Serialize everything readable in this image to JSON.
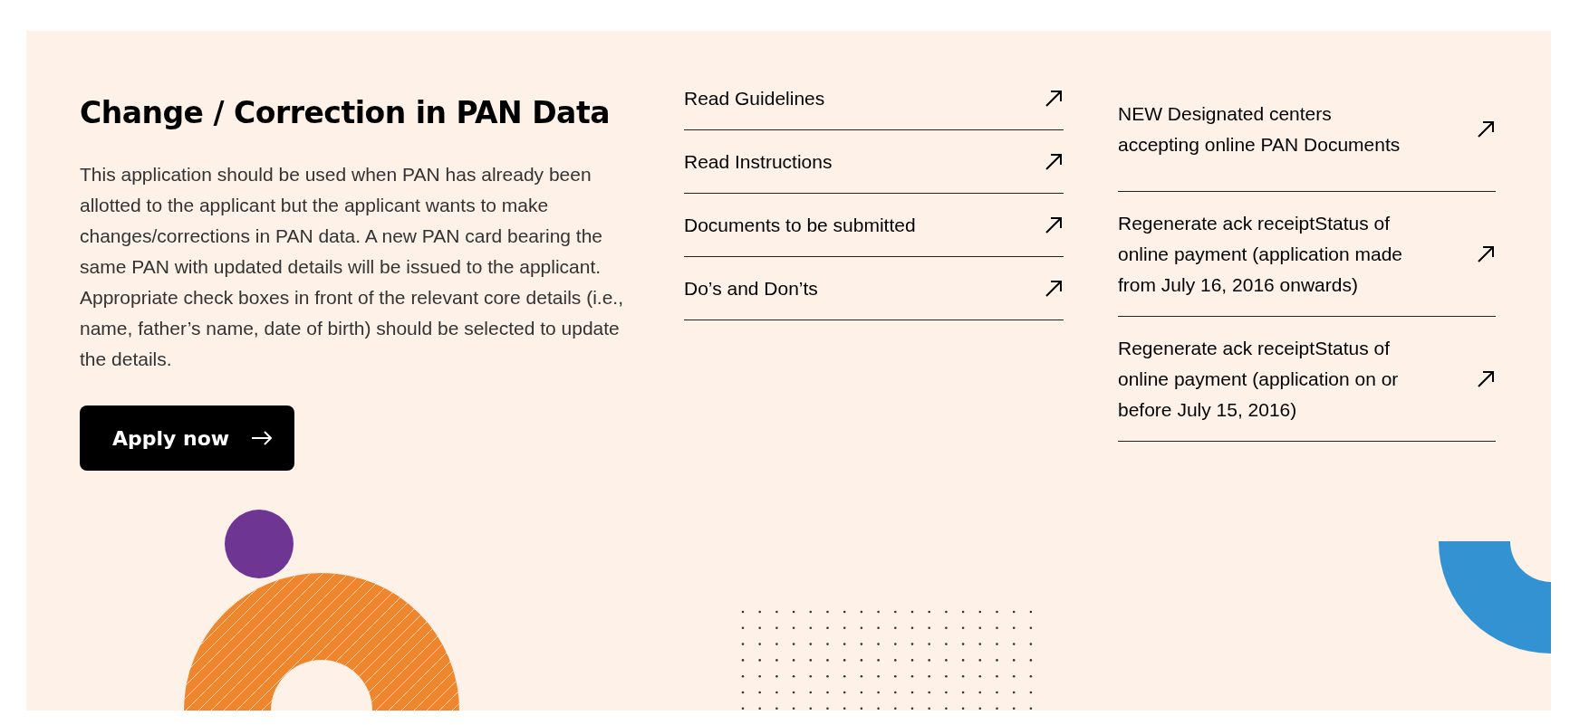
{
  "section": {
    "title": "Change / Correction in PAN Data",
    "description": "This application should be used when PAN has already been allotted to the applicant but the applicant wants to make changes/corrections in PAN data. A new PAN card bearing the same PAN with updated details will be issued to the applicant. Appropriate check boxes in front of the relevant core details (i.e., name, father’s name, date of birth) should be selected to update the details.",
    "button": {
      "label": "Apply now"
    }
  },
  "link_columns": [
    [
      {
        "label": "Read Guidelines"
      },
      {
        "label": "Read Instructions"
      },
      {
        "label": "Documents to be submitted"
      },
      {
        "label": "Do’s and Don’ts"
      }
    ],
    [
      {
        "label": "NEW Designated centers accepting online PAN Documents"
      },
      {
        "label": "Regenerate ack receiptStatus of online payment (application made from July 16, 2016 onwards)"
      },
      {
        "label": "Regenerate ack receiptStatus of online payment (application on or before July 15, 2016)"
      }
    ]
  ]
}
